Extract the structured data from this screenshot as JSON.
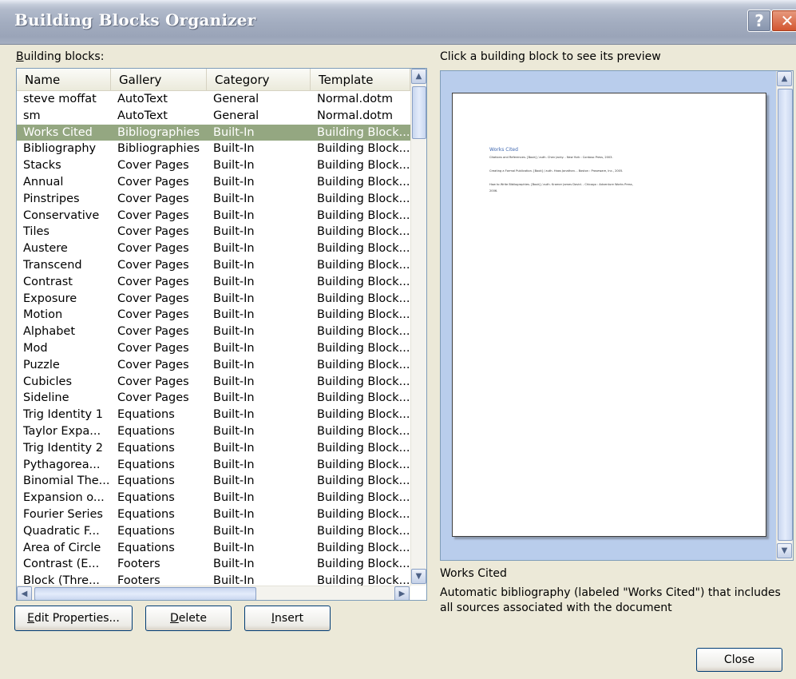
{
  "window": {
    "title": "Building Blocks Organizer",
    "help_glyph": "?",
    "close_glyph": "✕"
  },
  "list": {
    "label": "Building blocks:",
    "columns": [
      "Name",
      "Gallery",
      "Category",
      "Template"
    ],
    "rows": [
      [
        "steve moffat",
        "AutoText",
        "General",
        "Normal.dotm"
      ],
      [
        "sm",
        "AutoText",
        "General",
        "Normal.dotm"
      ],
      [
        "Works Cited",
        "Bibliographies",
        "Built-In",
        "Building Block..."
      ],
      [
        "Bibliography",
        "Bibliographies",
        "Built-In",
        "Building Block..."
      ],
      [
        "Stacks",
        "Cover Pages",
        "Built-In",
        "Building Block..."
      ],
      [
        "Annual",
        "Cover Pages",
        "Built-In",
        "Building Block..."
      ],
      [
        "Pinstripes",
        "Cover Pages",
        "Built-In",
        "Building Block..."
      ],
      [
        "Conservative",
        "Cover Pages",
        "Built-In",
        "Building Block..."
      ],
      [
        "Tiles",
        "Cover Pages",
        "Built-In",
        "Building Block..."
      ],
      [
        "Austere",
        "Cover Pages",
        "Built-In",
        "Building Block..."
      ],
      [
        "Transcend",
        "Cover Pages",
        "Built-In",
        "Building Block..."
      ],
      [
        "Contrast",
        "Cover Pages",
        "Built-In",
        "Building Block..."
      ],
      [
        "Exposure",
        "Cover Pages",
        "Built-In",
        "Building Block..."
      ],
      [
        "Motion",
        "Cover Pages",
        "Built-In",
        "Building Block..."
      ],
      [
        "Alphabet",
        "Cover Pages",
        "Built-In",
        "Building Block..."
      ],
      [
        "Mod",
        "Cover Pages",
        "Built-In",
        "Building Block..."
      ],
      [
        "Puzzle",
        "Cover Pages",
        "Built-In",
        "Building Block..."
      ],
      [
        "Cubicles",
        "Cover Pages",
        "Built-In",
        "Building Block..."
      ],
      [
        "Sideline",
        "Cover Pages",
        "Built-In",
        "Building Block..."
      ],
      [
        "Trig Identity 1",
        "Equations",
        "Built-In",
        "Building Block..."
      ],
      [
        "Taylor Expa...",
        "Equations",
        "Built-In",
        "Building Block..."
      ],
      [
        "Trig Identity 2",
        "Equations",
        "Built-In",
        "Building Block..."
      ],
      [
        "Pythagorea...",
        "Equations",
        "Built-In",
        "Building Block..."
      ],
      [
        "Binomial The...",
        "Equations",
        "Built-In",
        "Building Block..."
      ],
      [
        "Expansion o...",
        "Equations",
        "Built-In",
        "Building Block..."
      ],
      [
        "Fourier Series",
        "Equations",
        "Built-In",
        "Building Block..."
      ],
      [
        "Quadratic F...",
        "Equations",
        "Built-In",
        "Building Block..."
      ],
      [
        "Area of Circle",
        "Equations",
        "Built-In",
        "Building Block..."
      ],
      [
        "Contrast (E...",
        "Footers",
        "Built-In",
        "Building Block..."
      ],
      [
        "Block (Thre...",
        "Footers",
        "Built-In",
        "Building Block..."
      ]
    ],
    "selected_row": "Works Cited"
  },
  "buttons": {
    "edit_properties": "Edit Properties...",
    "delete": "Delete",
    "insert": "Insert",
    "close": "Close"
  },
  "preview": {
    "label": "Click a building block to see its preview",
    "doc_title": "Works Cited",
    "doc_lines": [
      "Citations and References. [Book] / auth. Chen Jacky. - New York : Contoso Press, 2003.",
      "Creating a Formal Publication. [Book] / auth. Haas Jonathan. - Boston : Proseware, Inc., 2005.",
      "How to Write Bibliographies. [Book] / auth. Kramer James David. - Chicago : Adventure Works Press,",
      "2006."
    ]
  },
  "selection": {
    "name": "Works Cited",
    "description": "Automatic bibliography (labeled \"Works Cited\") that includes all sources associated with the document"
  }
}
